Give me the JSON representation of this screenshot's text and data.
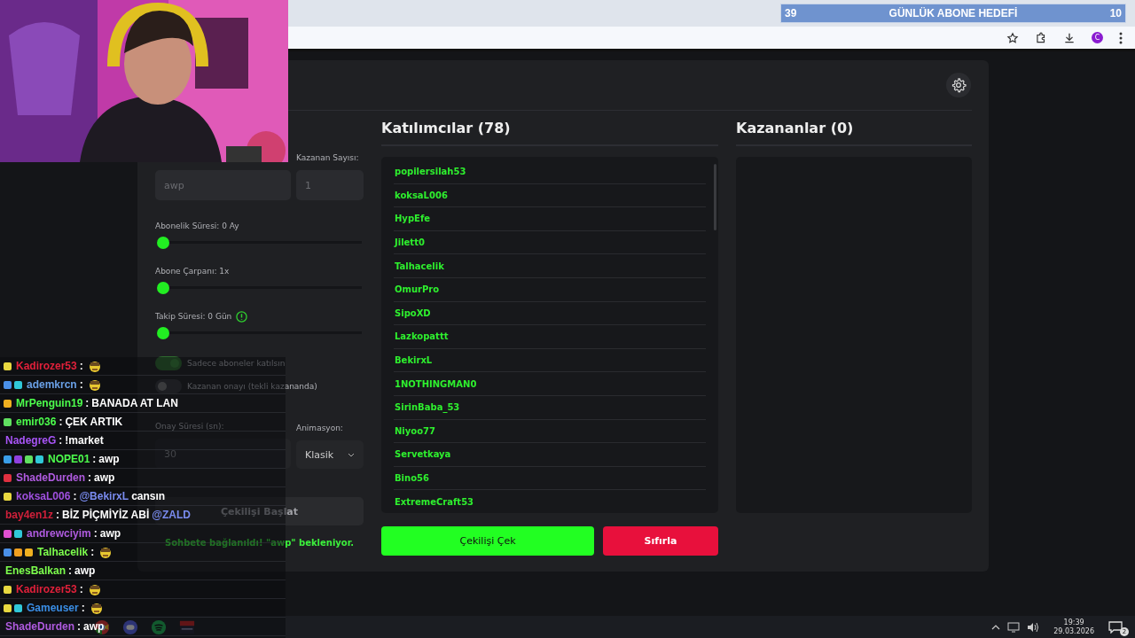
{
  "browser": {
    "goal": {
      "current": "39",
      "title": "GÜNLÜK ABONE HEDEFİ",
      "target": "10"
    },
    "profile_initial": "C"
  },
  "settings": {
    "winner_count_label": "Kazanan Sayısı:",
    "keyword_value": "awp",
    "winner_count_value": "1",
    "sliders": [
      {
        "label": "Abonelik Süresi: 0 Ay",
        "level": 0
      },
      {
        "label": "Abone Çarpanı: 1x",
        "level": 0
      },
      {
        "label": "Takip Süresi:  0  Gün",
        "level": 0,
        "info": true
      }
    ],
    "toggles": [
      {
        "label": "Sadece aboneler katılsın",
        "on": true
      },
      {
        "label": "Kazanan onayı (tekli kazananda)",
        "on": false
      }
    ],
    "confirm_label": "Onay Süresi (sn):",
    "confirm_value": "30",
    "animation_label": "Animasyon:",
    "animation_value": "Klasik",
    "start_button": {
      "label": "Çekilişi Başlat",
      "disabled": true
    },
    "status": "Sohbete bağlanıldı! \"awp\" bekleniyor."
  },
  "participants": {
    "title": "Katılımcılar (78)",
    "items": [
      "popilersilah53",
      "koksaL006",
      "HypEfe",
      "Jilett0",
      "Talhacelik",
      "OmurPro",
      "SipoXD",
      "Lazkopattt",
      "BekirxL",
      "1NOTHINGMAN0",
      "SirinBaba_53",
      "Niyoo77",
      "Servetkaya",
      "Bino56",
      "ExtremeCraft53"
    ]
  },
  "winners": {
    "title": "Kazananlar (0)"
  },
  "draw_button": "Çekilişi Çek",
  "reset_button": "Sıfırla",
  "chat": [
    {
      "user": "Kadirozer53",
      "color": "#e0203a",
      "badges": [
        {
          "color": "#e8d840"
        }
      ],
      "separator": ":",
      "emote": true
    },
    {
      "user": "ademkrcn",
      "color": "#6aa0e6",
      "badges": [
        {
          "color": "#4a90e8"
        },
        {
          "color": "#30c8d8"
        }
      ],
      "separator": ":",
      "emote": true
    },
    {
      "user": "MrPenguin19",
      "color": "#4dff4d",
      "badges": [
        {
          "color": "#f0b020"
        }
      ],
      "separator": ":",
      "segments": [
        {
          "kind": "text",
          "text": "BANADA AT LAN"
        }
      ]
    },
    {
      "user": "emir036",
      "color": "#4dff4d",
      "badges": [
        {
          "color": "#60e060"
        }
      ],
      "separator": ":",
      "segments": [
        {
          "kind": "text",
          "text": "ÇEK ARTIK"
        }
      ]
    },
    {
      "user": "NadegreG",
      "color": "#a855f7",
      "separator": ":",
      "segments": [
        {
          "kind": "text",
          "text": "!market"
        }
      ]
    },
    {
      "user": "NOPE01",
      "color": "#4dff4d",
      "badges": [
        {
          "color": "#3a9ee8"
        },
        {
          "color": "#9040e0"
        },
        {
          "color": "#60e060"
        },
        {
          "color": "#30c8d8"
        }
      ],
      "separator": ":",
      "segments": [
        {
          "kind": "text",
          "text": "awp"
        }
      ]
    },
    {
      "user": "ShadeDurden",
      "color": "#b05be0",
      "badges": [
        {
          "color": "#e03040"
        }
      ],
      "separator": ":",
      "segments": [
        {
          "kind": "text",
          "text": "awp"
        }
      ]
    },
    {
      "user": "koksaL006",
      "color": "#a050e0",
      "badges": [
        {
          "color": "#e8d840"
        }
      ],
      "separator": ":",
      "segments": [
        {
          "kind": "mention",
          "text": "@BekirxL"
        },
        {
          "kind": "text",
          "text": "cansın"
        }
      ]
    },
    {
      "user": "bay4en1z",
      "color": "#d0203a",
      "separator": ":",
      "segments": [
        {
          "kind": "text",
          "text": "BİZ PİÇMİYİZ ABİ"
        },
        {
          "kind": "mention",
          "text": "@ZALD"
        }
      ]
    },
    {
      "user": "andrewciyim",
      "color": "#b05be0",
      "badges": [
        {
          "color": "#e050d0"
        },
        {
          "color": "#30c8d8"
        }
      ],
      "separator": ":",
      "segments": [
        {
          "kind": "text",
          "text": "awp"
        }
      ]
    },
    {
      "user": "Talhacelik",
      "color": "#7dff4d",
      "badges": [
        {
          "color": "#4a90e8"
        },
        {
          "color": "#f0a020"
        },
        {
          "color": "#f0b020"
        }
      ],
      "separator": ":",
      "emote": true
    },
    {
      "user": "EnesBalkan",
      "color": "#7dff4d",
      "separator": ":",
      "segments": [
        {
          "kind": "text",
          "text": "awp"
        }
      ]
    },
    {
      "user": "Kadirozer53",
      "color": "#e0203a",
      "badges": [
        {
          "color": "#e8d840"
        }
      ],
      "separator": ":",
      "emote": true
    },
    {
      "user": "Gameuser",
      "color": "#3a8ee6",
      "badges": [
        {
          "color": "#e8d840"
        },
        {
          "color": "#30c8d8"
        }
      ],
      "separator": ":",
      "emote": true
    },
    {
      "user": "ShadeDurden",
      "color": "#b05be0",
      "separator": ":",
      "segments": [
        {
          "kind": "text",
          "text": "awp"
        }
      ]
    }
  ],
  "taskbar": {
    "time": "19:39",
    "date": "29.03.2026",
    "notifications": "2"
  }
}
